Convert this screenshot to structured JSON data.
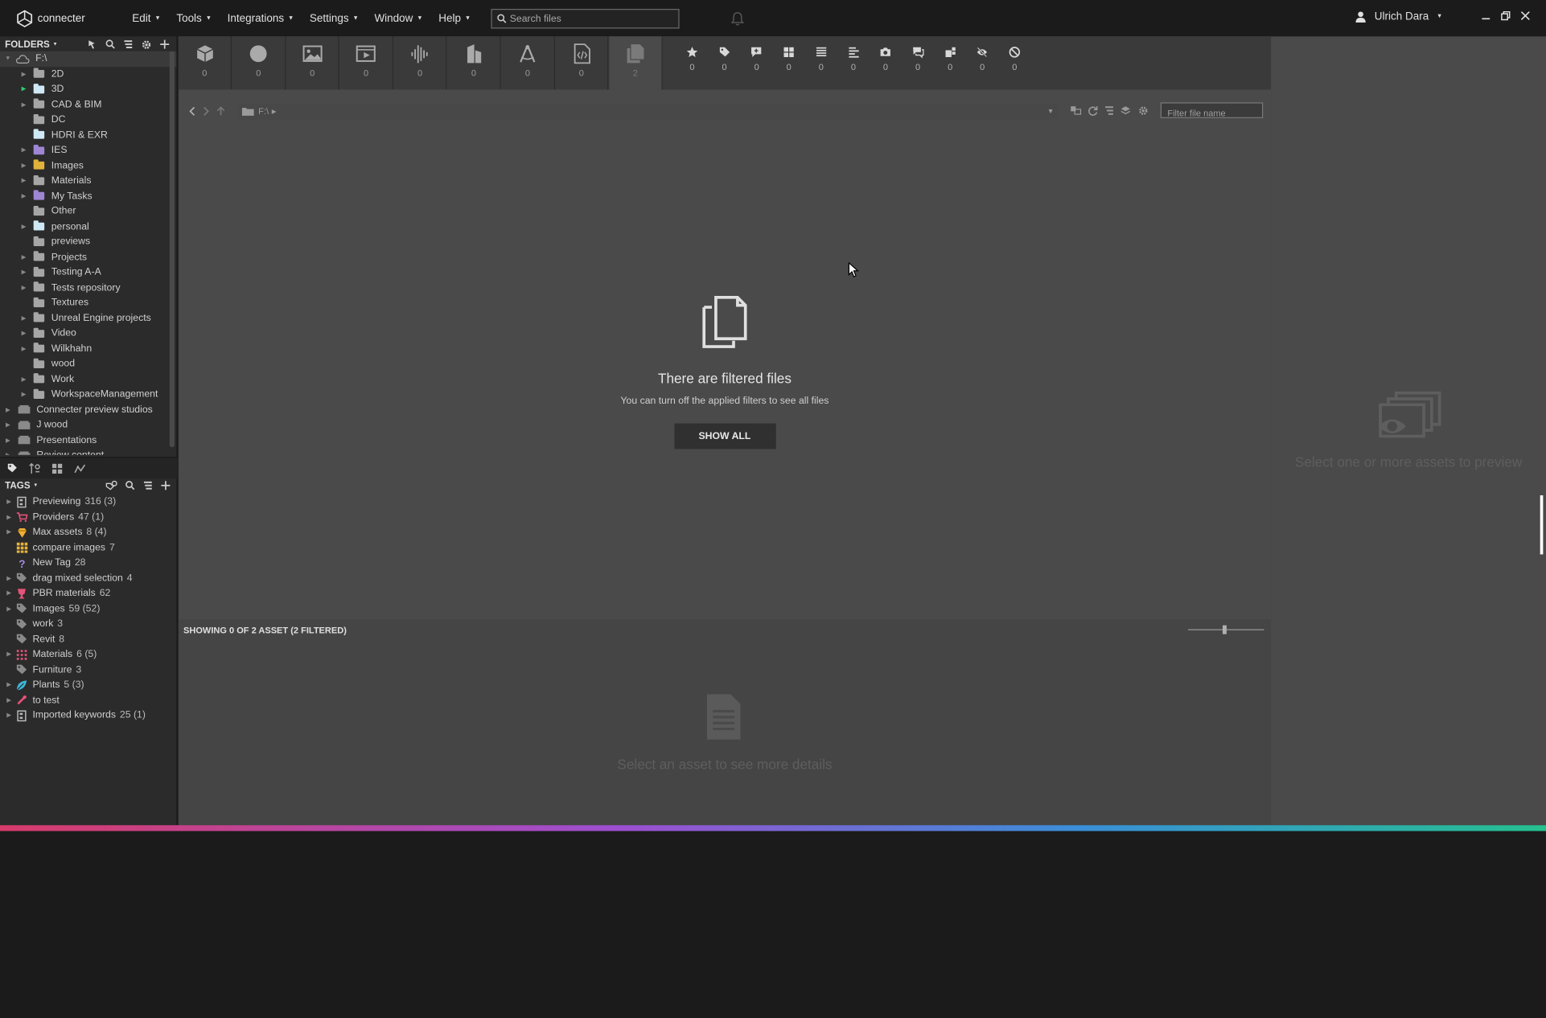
{
  "app": {
    "name": "connecter",
    "menu": [
      "Edit",
      "Tools",
      "Integrations",
      "Settings",
      "Window",
      "Help"
    ],
    "search_placeholder": "Search files",
    "user_name": "Ulrich Dara",
    "window_controls": [
      "minimize",
      "restore",
      "close"
    ]
  },
  "folders_panel": {
    "header": "FOLDERS",
    "tools": [
      "select-icon",
      "search-icon",
      "list-icon",
      "gear-icon",
      "plus-icon"
    ],
    "root": "F:\\",
    "items": [
      {
        "label": "2D",
        "color": "#a6a6a6"
      },
      {
        "label": "3D",
        "color": "#cfe8f5"
      },
      {
        "label": "CAD & BIM",
        "color": "#a6a6a6"
      },
      {
        "label": "DC",
        "color": "#a6a6a6"
      },
      {
        "label": "HDRI & EXR",
        "color": "#cfe8f5"
      },
      {
        "label": "IES",
        "color": "#9f86d4"
      },
      {
        "label": "Images",
        "color": "#e0b23a"
      },
      {
        "label": "Materials",
        "color": "#a6a6a6"
      },
      {
        "label": "My Tasks",
        "color": "#9f86d4"
      },
      {
        "label": "Other",
        "color": "#a6a6a6"
      },
      {
        "label": "personal",
        "color": "#cfe8f5"
      },
      {
        "label": "previews",
        "color": "#a6a6a6"
      },
      {
        "label": "Projects",
        "color": "#a6a6a6"
      },
      {
        "label": "Testing A-A",
        "color": "#a6a6a6"
      },
      {
        "label": "Tests repository",
        "color": "#a6a6a6"
      },
      {
        "label": "Textures",
        "color": "#a6a6a6"
      },
      {
        "label": "Unreal Engine projects",
        "color": "#a6a6a6"
      },
      {
        "label": "Video",
        "color": "#a6a6a6"
      },
      {
        "label": "Wilkhahn",
        "color": "#a6a6a6"
      },
      {
        "label": "wood",
        "color": "#a6a6a6"
      },
      {
        "label": "Work",
        "color": "#a6a6a6"
      },
      {
        "label": "WorkspaceManagement",
        "color": "#a6a6a6"
      }
    ],
    "workspaces": [
      "Connecter preview studios",
      "J wood",
      "Presentations",
      "Review content"
    ]
  },
  "tags_panel": {
    "header": "TAGS",
    "tools": [
      "tag-filter-icon",
      "search-icon",
      "list-icon",
      "plus-icon"
    ],
    "items": [
      {
        "label": "Previewing",
        "count": "316 (3)",
        "icon": "tag-group-icon"
      },
      {
        "label": "Providers",
        "count": "47 (1)",
        "icon": "cart-icon"
      },
      {
        "label": "Max assets",
        "count": "8 (4)",
        "icon": "gem-icon"
      },
      {
        "label": "compare images",
        "count": "7",
        "icon": "grid-icon"
      },
      {
        "label": "New Tag",
        "count": "28",
        "icon": "question-icon"
      },
      {
        "label": "drag mixed selection",
        "count": "4",
        "icon": "tag-icon"
      },
      {
        "label": "PBR materials",
        "count": "62",
        "icon": "trophy-icon"
      },
      {
        "label": "Images",
        "count": "59 (52)",
        "icon": "tag-icon"
      },
      {
        "label": "work",
        "count": "3",
        "icon": "tag-icon"
      },
      {
        "label": "Revit",
        "count": "8",
        "icon": "tag-icon"
      },
      {
        "label": "Materials",
        "count": "6 (5)",
        "icon": "dots-grid-icon"
      },
      {
        "label": "Furniture",
        "count": "3",
        "icon": "tag-icon"
      },
      {
        "label": "Plants",
        "count": "5 (3)",
        "icon": "leaf-icon"
      },
      {
        "label": "to test",
        "count": "",
        "icon": "wrench-icon"
      },
      {
        "label": "Imported keywords",
        "count": "25 (1)",
        "icon": "tag-group-icon"
      }
    ]
  },
  "type_filters": [
    {
      "icon": "cube-icon",
      "count": "0"
    },
    {
      "icon": "sphere-icon",
      "count": "0"
    },
    {
      "icon": "image-icon",
      "count": "0"
    },
    {
      "icon": "video-icon",
      "count": "0"
    },
    {
      "icon": "audio-icon",
      "count": "0"
    },
    {
      "icon": "building-icon",
      "count": "0"
    },
    {
      "icon": "drafting-icon",
      "count": "0"
    },
    {
      "icon": "code-file-icon",
      "count": "0"
    },
    {
      "icon": "files-icon",
      "count": "2"
    }
  ],
  "attribute_filters": [
    {
      "icon": "star-icon",
      "count": "0"
    },
    {
      "icon": "tag-icon",
      "count": "0"
    },
    {
      "icon": "comment-plus-icon",
      "count": "0"
    },
    {
      "icon": "grid-icon",
      "count": "0"
    },
    {
      "icon": "list-icon",
      "count": "0"
    },
    {
      "icon": "align-icon",
      "count": "0"
    },
    {
      "icon": "camera-icon",
      "count": "0"
    },
    {
      "icon": "chat-icon",
      "count": "0"
    },
    {
      "icon": "stack-icon",
      "count": "0"
    },
    {
      "icon": "hidden-icon",
      "count": "0"
    },
    {
      "icon": "blocked-icon",
      "count": "0"
    }
  ],
  "path_bar": {
    "path": "F:\\",
    "filter_placeholder": "Filter file name"
  },
  "empty_state": {
    "title": "There are filtered files",
    "subtitle": "You can turn off the applied filters to see all files",
    "button": "SHOW ALL"
  },
  "status": {
    "text": "SHOWING 0 OF 2 ASSET (2 FILTERED)"
  },
  "details": {
    "hint": "Select an asset to see more details"
  },
  "preview": {
    "hint": "Select one or more assets to preview"
  }
}
